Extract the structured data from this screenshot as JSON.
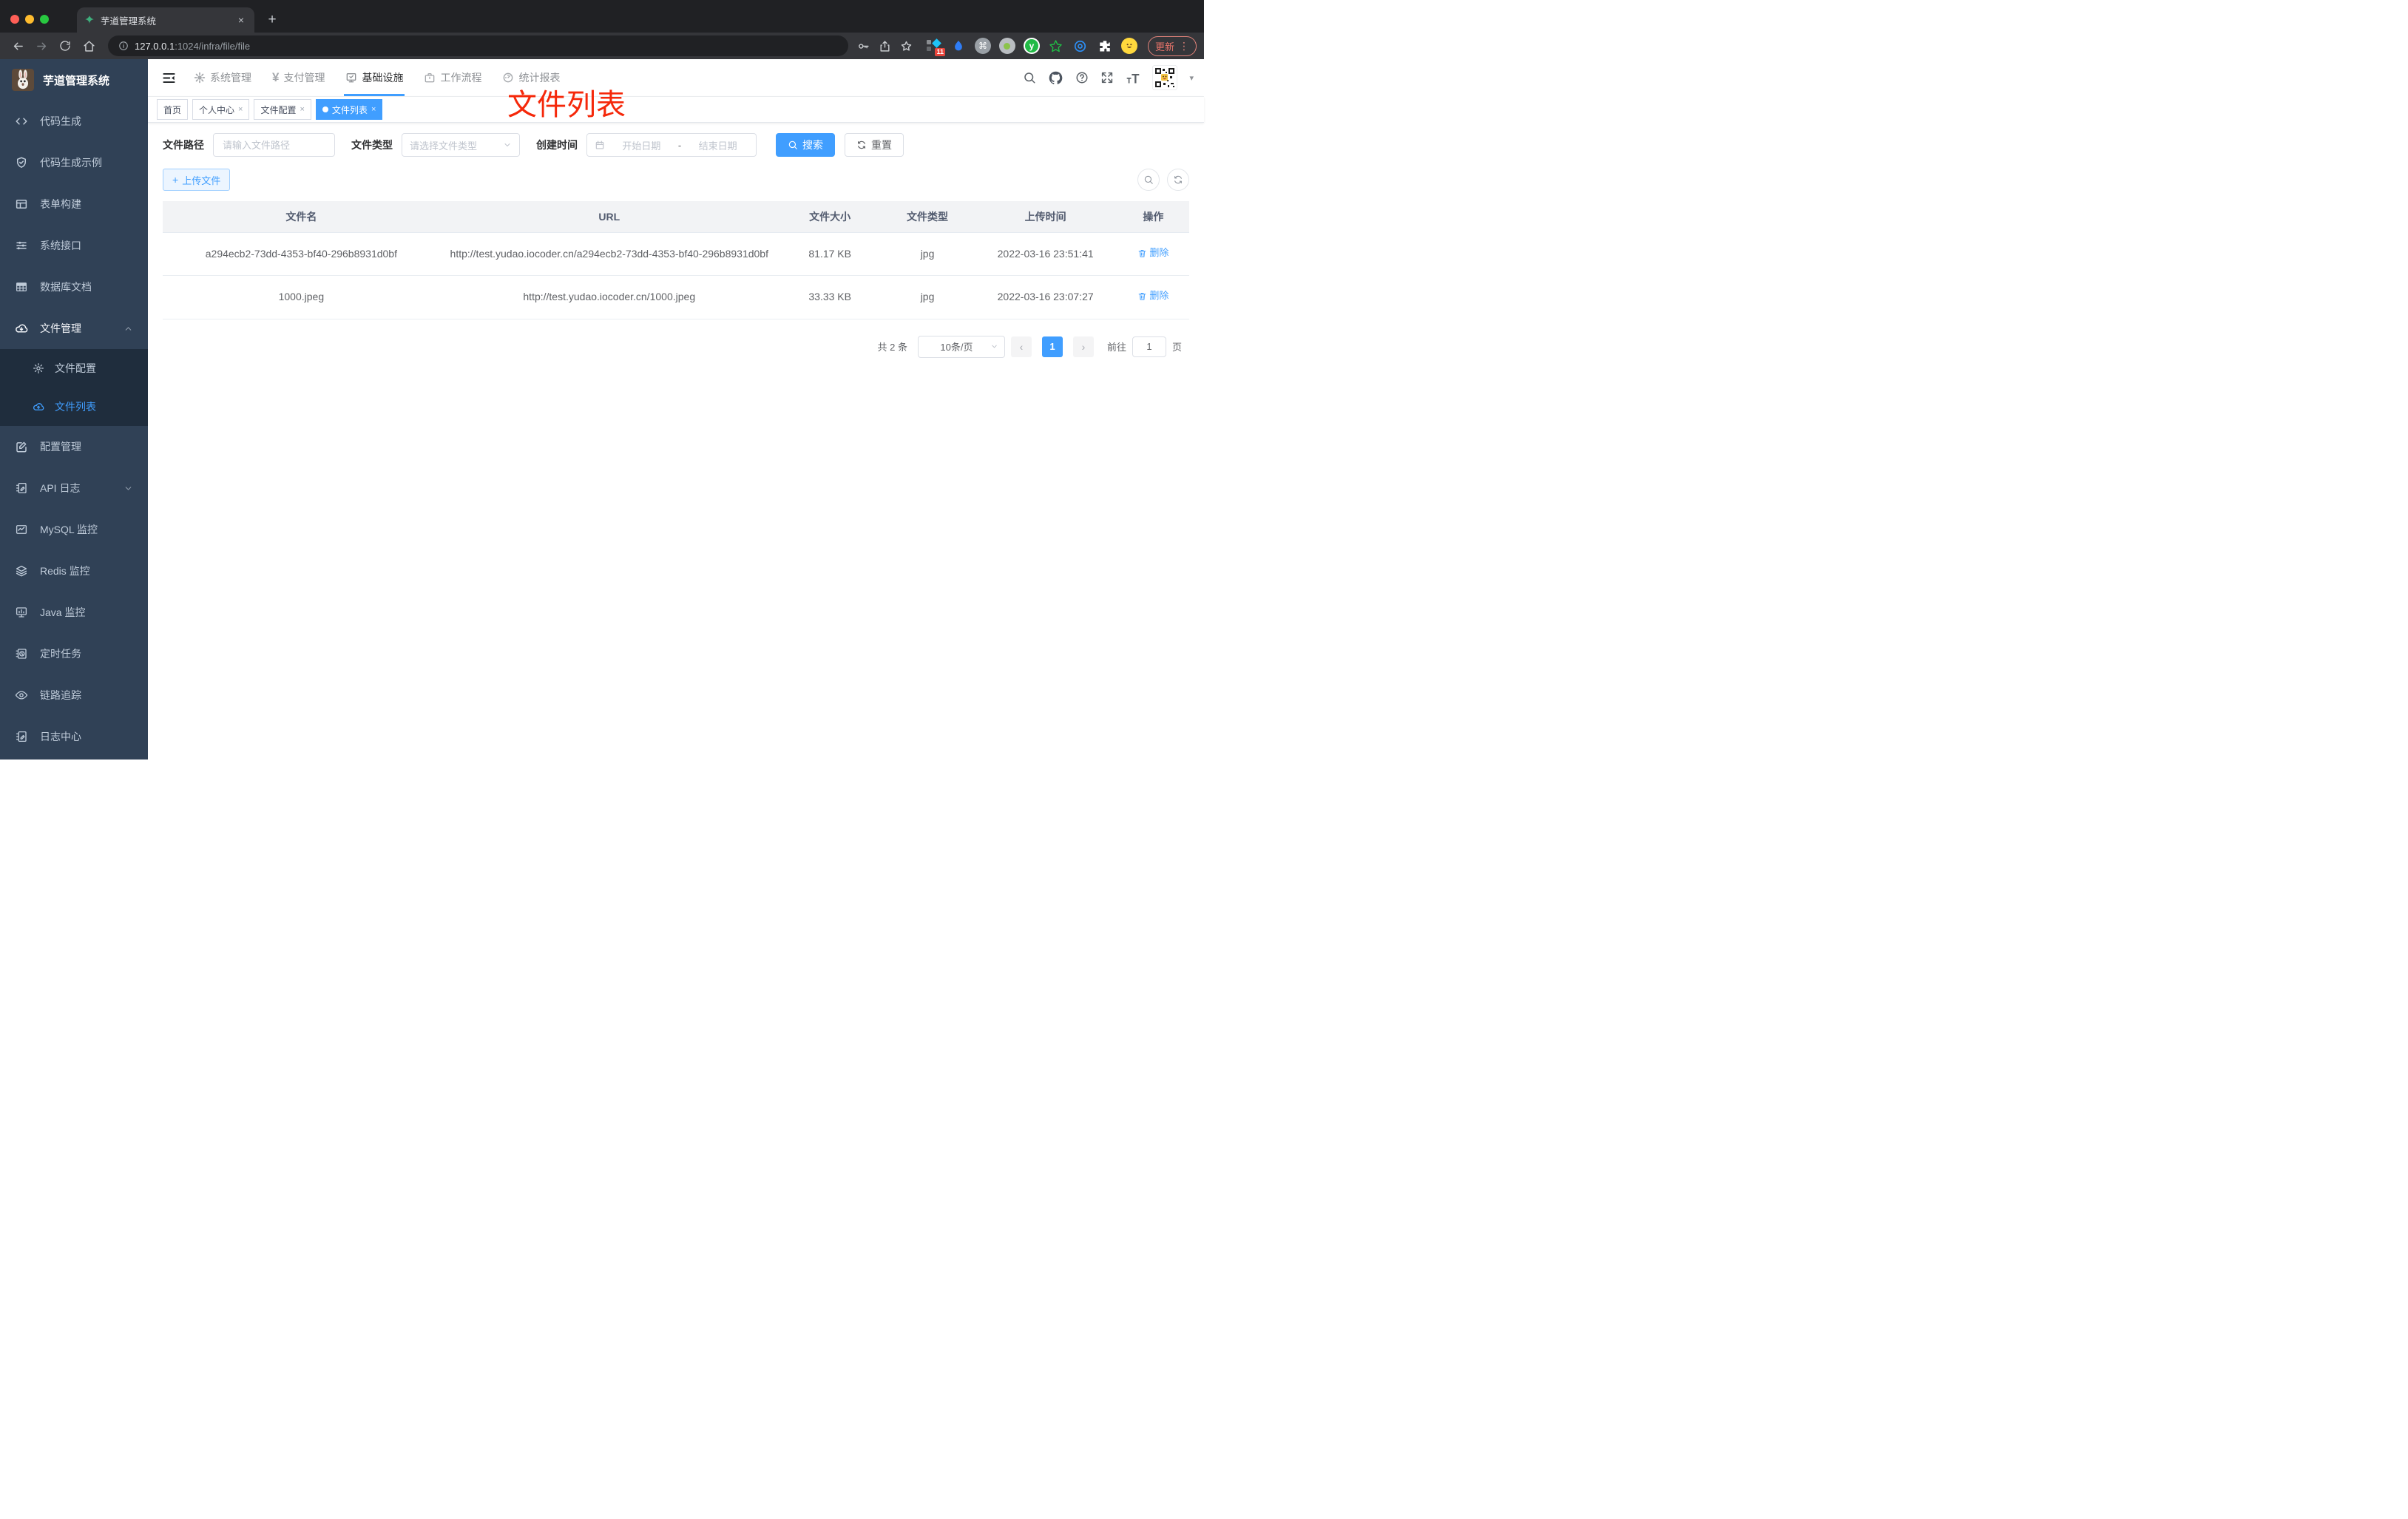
{
  "glyphs": {
    "close": "×",
    "plus": "+",
    "kebab": "⋮",
    "prev": "‹",
    "next": "›",
    "caret": "▾",
    "cmd": "⌘",
    "yen": "¥",
    "y": "y"
  },
  "browser": {
    "tab_title": "芋道管理系统",
    "url_host": "127.0.0.1",
    "url_rest": ":1024/infra/file/file",
    "extension_badge": "11",
    "update_button": "更新"
  },
  "sidebar": {
    "logo_title": "芋道管理系统",
    "items": [
      {
        "label": "代码生成"
      },
      {
        "label": "代码生成示例"
      },
      {
        "label": "表单构建"
      },
      {
        "label": "系统接口"
      },
      {
        "label": "数据库文档"
      },
      {
        "label": "文件管理",
        "children": [
          {
            "label": "文件配置"
          },
          {
            "label": "文件列表"
          }
        ]
      },
      {
        "label": "配置管理"
      },
      {
        "label": "API 日志"
      },
      {
        "label": "MySQL 监控"
      },
      {
        "label": "Redis 监控"
      },
      {
        "label": "Java 监控"
      },
      {
        "label": "定时任务"
      },
      {
        "label": "链路追踪"
      },
      {
        "label": "日志中心"
      }
    ]
  },
  "topnav": {
    "items": [
      {
        "label": "系统管理"
      },
      {
        "label": "支付管理"
      },
      {
        "label": "基础设施"
      },
      {
        "label": "工作流程"
      },
      {
        "label": "统计报表"
      }
    ]
  },
  "tags": {
    "items": [
      {
        "label": "首页"
      },
      {
        "label": "个人中心"
      },
      {
        "label": "文件配置"
      },
      {
        "label": "文件列表"
      }
    ]
  },
  "annotation": {
    "text": "文件列表"
  },
  "filters": {
    "path_label": "文件路径",
    "path_placeholder": "请输入文件路径",
    "type_label": "文件类型",
    "type_placeholder": "请选择文件类型",
    "date_label": "创建时间",
    "date_start_placeholder": "开始日期",
    "date_separator": "-",
    "date_end_placeholder": "结束日期",
    "search_label": "搜索",
    "reset_label": "重置"
  },
  "toolbar": {
    "upload_label": "上传文件"
  },
  "table": {
    "columns": [
      "文件名",
      "URL",
      "文件大小",
      "文件类型",
      "上传时间",
      "操作"
    ],
    "rows": [
      {
        "name": "a294ecb2-73dd-4353-bf40-296b8931d0bf",
        "url": "http://test.yudao.iocoder.cn/a294ecb2-73dd-4353-bf40-296b8931d0bf",
        "size": "81.17 KB",
        "type": "jpg",
        "time": "2022-03-16 23:51:41",
        "action": "删除"
      },
      {
        "name": "1000.jpeg",
        "url": "http://test.yudao.iocoder.cn/1000.jpeg",
        "size": "33.33 KB",
        "type": "jpg",
        "time": "2022-03-16 23:07:27",
        "action": "删除"
      }
    ]
  },
  "pagination": {
    "total": "共 2 条",
    "page_size": "10条/页",
    "current_page": "1",
    "goto_label": "前往",
    "goto_value": "1",
    "page_suffix": "页"
  },
  "colors": {
    "primary": "#409eff",
    "sidebar_bg": "#304156",
    "submenu_bg": "#1f2d3d",
    "annotation_red": "#f5280a"
  }
}
